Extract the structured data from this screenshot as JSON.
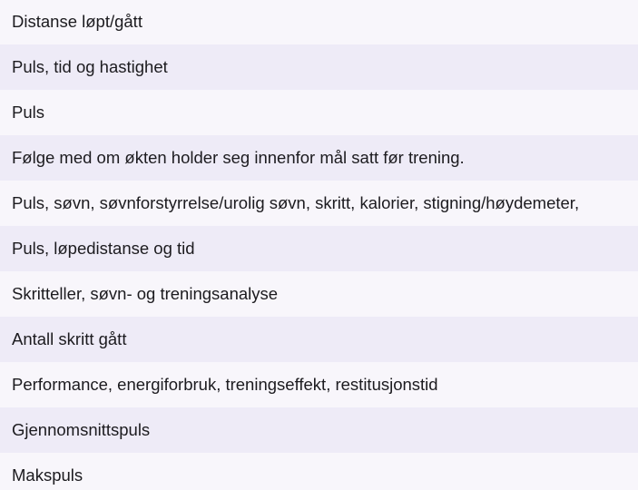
{
  "list": {
    "items": [
      {
        "text": "Distanse løpt/gått"
      },
      {
        "text": "Puls, tid og hastighet"
      },
      {
        "text": "Puls"
      },
      {
        "text": "Følge med om økten holder seg innenfor mål satt før trening."
      },
      {
        "text": "Puls, søvn, søvnforstyrrelse/urolig søvn, skritt, kalorier, stigning/høydemeter,"
      },
      {
        "text": "Puls, løpedistanse og tid"
      },
      {
        "text": "Skritteller, søvn- og treningsanalyse"
      },
      {
        "text": "Antall skritt gått"
      },
      {
        "text": "Performance, energiforbruk, treningseffekt, restitusjonstid"
      },
      {
        "text": "Gjennomsnittspuls"
      },
      {
        "text": "Makspuls"
      }
    ]
  },
  "colors": {
    "row_light": "#f8f6fb",
    "row_dark": "#eeebf7",
    "text": "#1c1b1f"
  }
}
